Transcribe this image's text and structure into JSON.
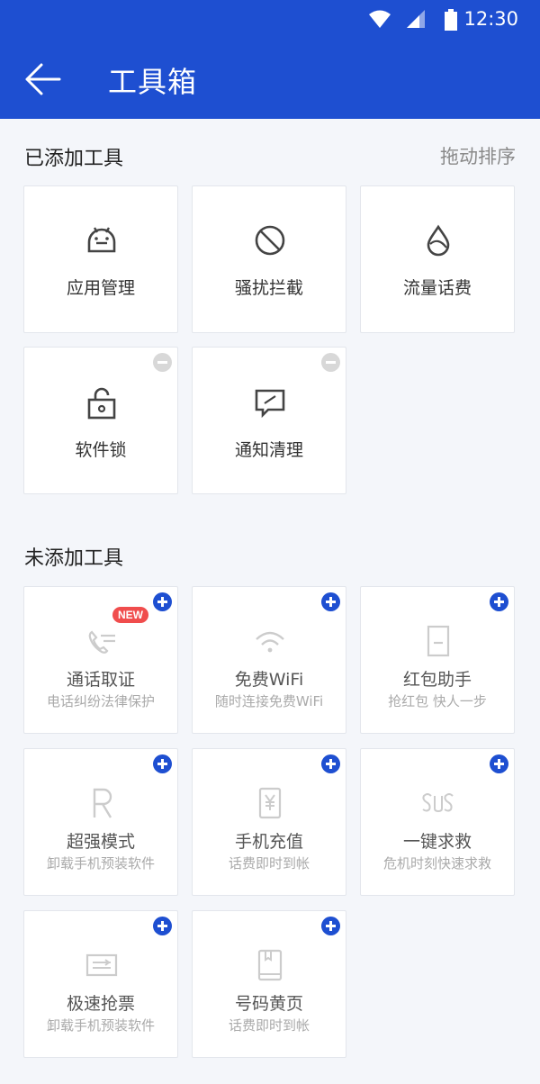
{
  "status": {
    "time": "12:30"
  },
  "appbar": {
    "title": "工具箱"
  },
  "added": {
    "title": "已添加工具",
    "sort_label": "拖动排序",
    "items": [
      {
        "label": "应用管理"
      },
      {
        "label": "骚扰拦截"
      },
      {
        "label": "流量话费"
      },
      {
        "label": "软件锁"
      },
      {
        "label": "通知清理"
      }
    ]
  },
  "available": {
    "title": "未添加工具",
    "items": [
      {
        "label": "通话取证",
        "sub": "电话纠纷法律保护",
        "tag": "NEW"
      },
      {
        "label": "免费WiFi",
        "sub": "随时连接免费WiFi"
      },
      {
        "label": "红包助手",
        "sub": "抢红包 快人一步"
      },
      {
        "label": "超强模式",
        "sub": "卸载手机预装软件"
      },
      {
        "label": "手机充值",
        "sub": "话费即时到帐"
      },
      {
        "label": "一键求救",
        "sub": "危机时刻快速求救"
      },
      {
        "label": "极速抢票",
        "sub": "卸载手机预装软件"
      },
      {
        "label": "号码黄页",
        "sub": "话费即时到帐"
      }
    ]
  },
  "icons": {
    "android": "android-icon",
    "block": "block-icon",
    "drop": "drop-icon",
    "lock": "lock-icon",
    "notify": "notification-clean-icon",
    "call": "call-record-icon",
    "wifi": "wifi-icon",
    "redpacket": "red-packet-icon",
    "r": "super-mode-icon",
    "yen": "recharge-icon",
    "sos": "sos-icon",
    "ticket": "ticket-icon",
    "book": "yellow-pages-icon"
  },
  "colors": {
    "primary": "#1e4fd1",
    "badge_new": "#f04d4d"
  }
}
